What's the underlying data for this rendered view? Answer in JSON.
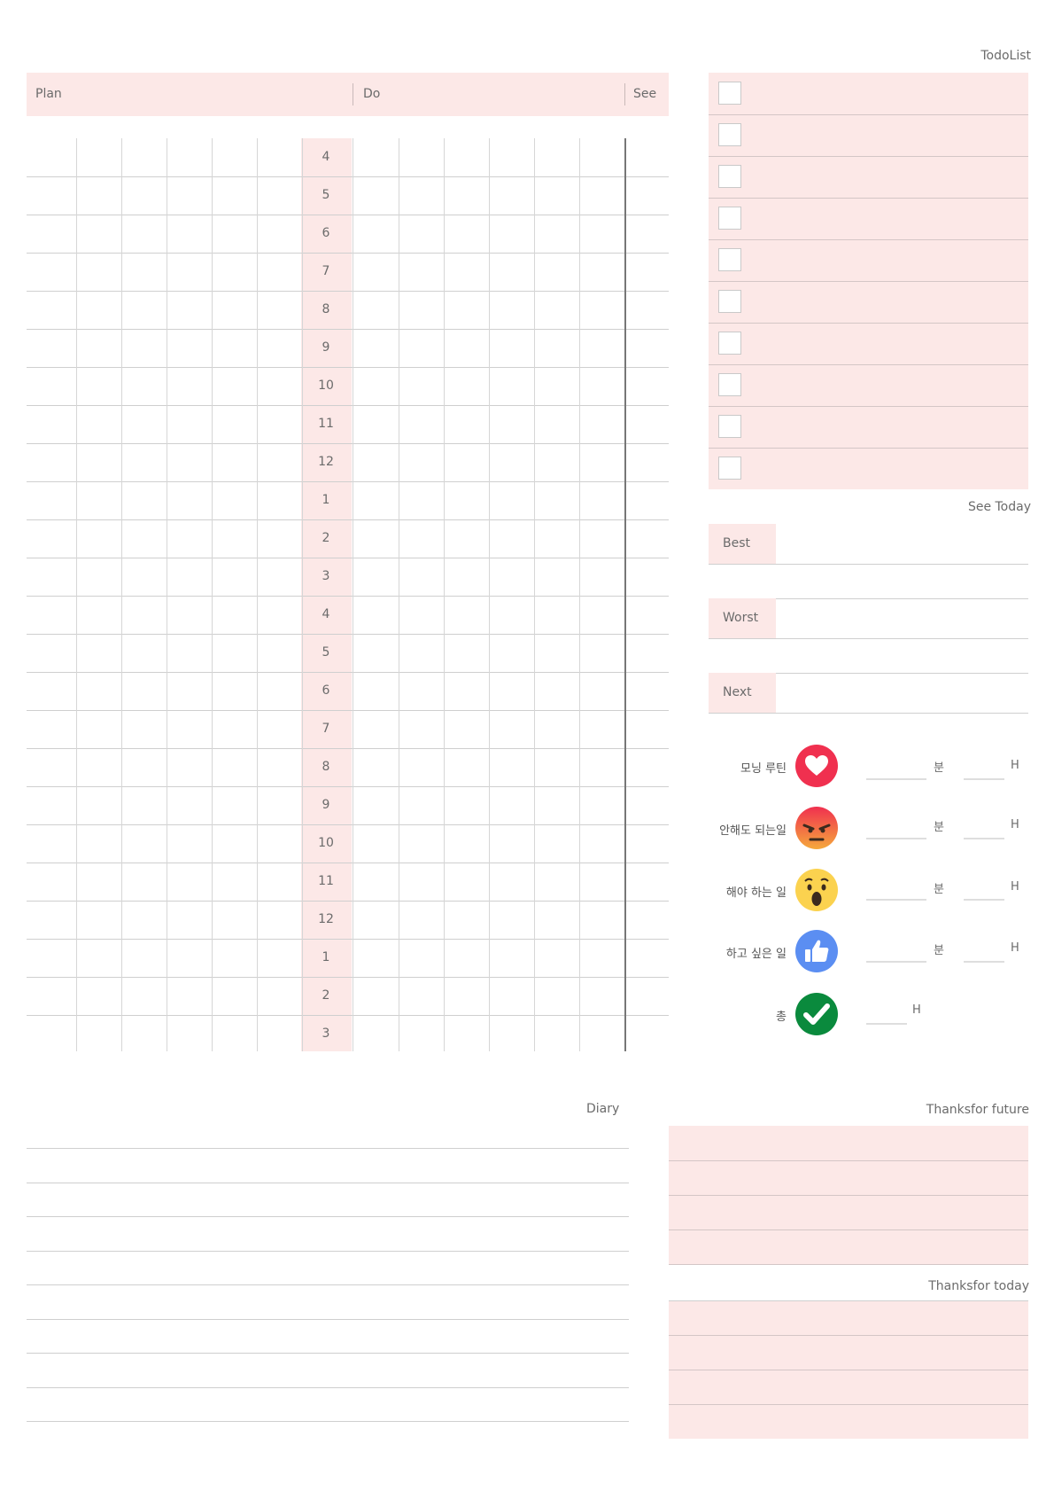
{
  "header": {
    "plan": "Plan",
    "do": "Do",
    "see": "See"
  },
  "hours": [
    "4",
    "5",
    "6",
    "7",
    "8",
    "9",
    "10",
    "11",
    "12",
    "1",
    "2",
    "3",
    "4",
    "5",
    "6",
    "7",
    "8",
    "9",
    "10",
    "11",
    "12",
    "1",
    "2",
    "3"
  ],
  "todo": {
    "title": "TodoList",
    "count": 10
  },
  "see_today": {
    "title": "See Today",
    "best": "Best",
    "worst": "Worst",
    "next": "Next"
  },
  "stats": [
    {
      "label": "모닝 루틴",
      "icon": "heart-icon",
      "minute_unit": "분",
      "hour_unit": "H"
    },
    {
      "label": "안해도 되는일",
      "icon": "angry-face-icon",
      "minute_unit": "분",
      "hour_unit": "H"
    },
    {
      "label": "해야 하는 일",
      "icon": "surprised-face-icon",
      "minute_unit": "분",
      "hour_unit": "H"
    },
    {
      "label": "하고 싶은 일",
      "icon": "thumbs-up-icon",
      "minute_unit": "분",
      "hour_unit": "H"
    }
  ],
  "total": {
    "label": "총",
    "icon": "checkmark-icon",
    "hour_unit": "H"
  },
  "diary": {
    "title": "Diary"
  },
  "thanks_future": {
    "title": "Thanksfor future"
  },
  "thanks_today": {
    "title": "Thanksfor today"
  },
  "colors": {
    "pink": "#fce8e7",
    "red": "#f0304f",
    "orange": "#f36a35",
    "yellow": "#fbd24f",
    "blue": "#5b8ef2",
    "green": "#0a8a3d"
  }
}
